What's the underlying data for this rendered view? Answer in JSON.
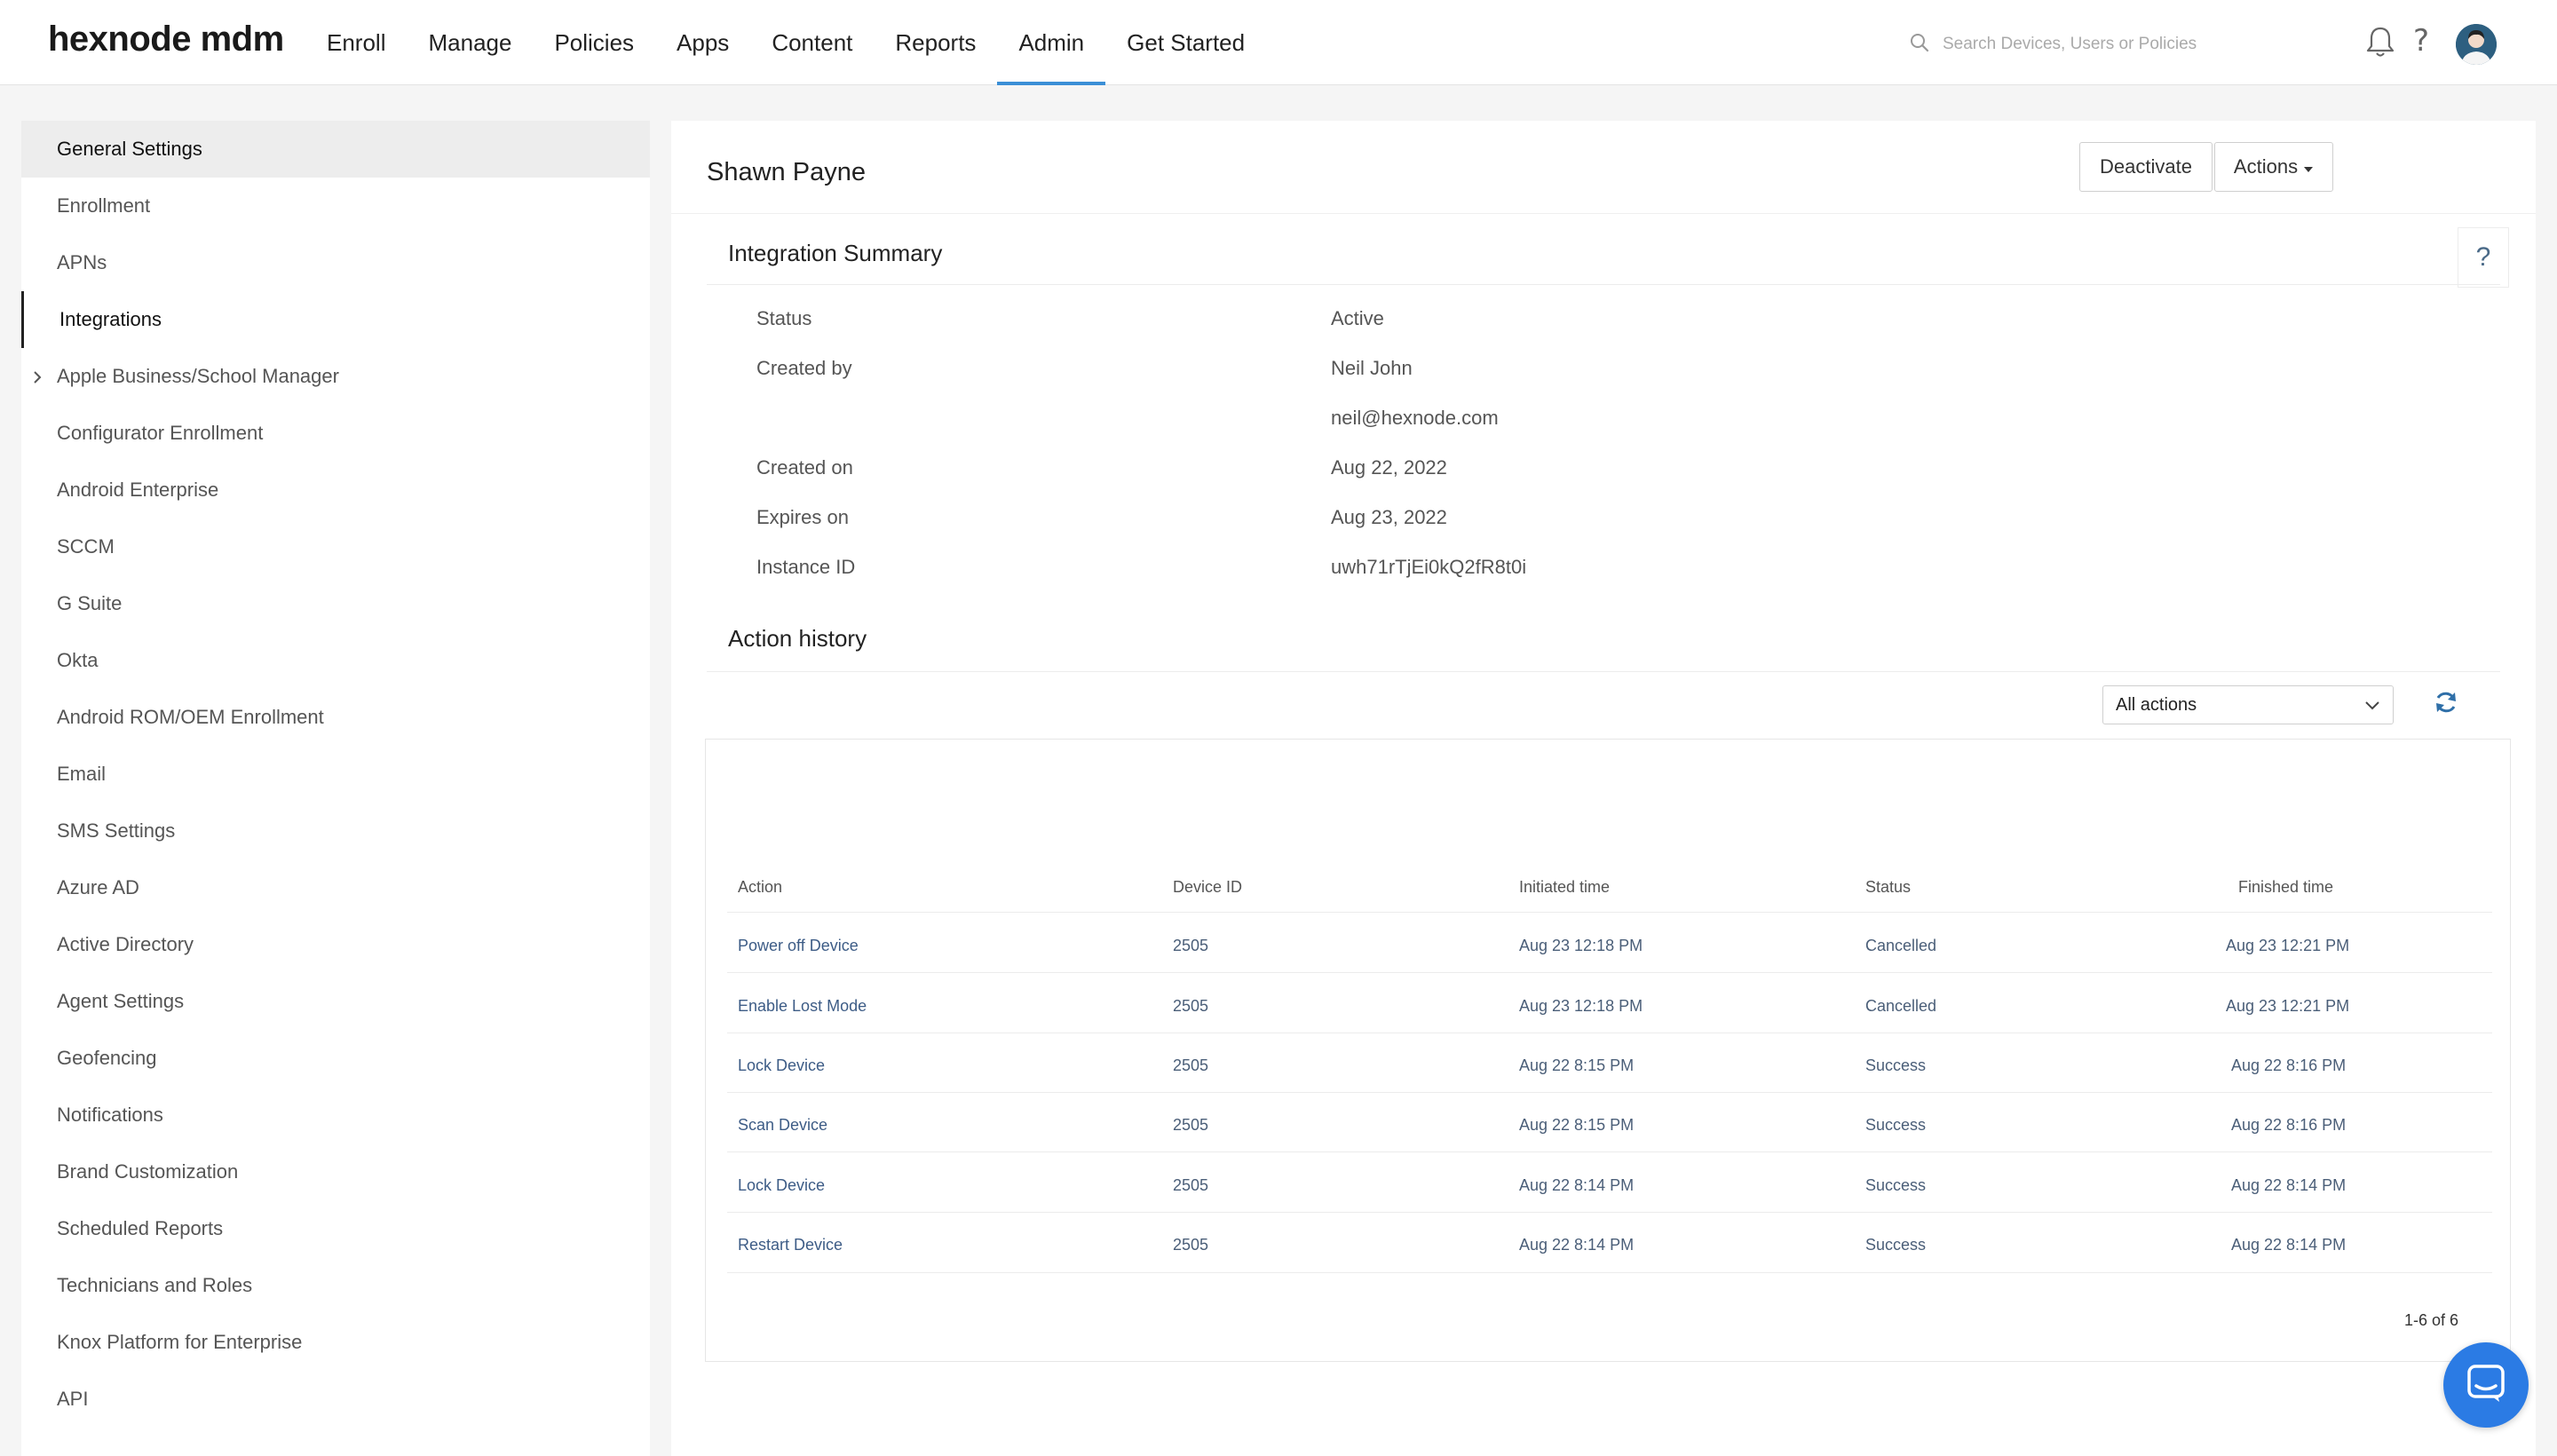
{
  "brand": "hexnode mdm",
  "nav": {
    "items": [
      "Enroll",
      "Manage",
      "Policies",
      "Apps",
      "Content",
      "Reports",
      "Admin",
      "Get Started"
    ],
    "active": "Admin"
  },
  "search": {
    "placeholder": "Search Devices, Users or Policies"
  },
  "sidebar": {
    "items": [
      "General Settings",
      "Enrollment",
      "APNs",
      "Integrations",
      "Apple Business/School Manager",
      "Configurator Enrollment",
      "Android Enterprise",
      "SCCM",
      "G Suite",
      "Okta",
      "Android ROM/OEM Enrollment",
      "Email",
      "SMS Settings",
      "Azure AD",
      "Active Directory",
      "Agent Settings",
      "Geofencing",
      "Notifications",
      "Brand Customization",
      "Scheduled Reports",
      "Technicians and Roles",
      "Knox Platform for Enterprise",
      "API"
    ],
    "selected": "Integrations"
  },
  "header": {
    "name": "Shawn Payne",
    "deactivate_label": "Deactivate",
    "actions_label": "Actions"
  },
  "summary": {
    "title": "Integration Summary",
    "help": "?",
    "status_label": "Status",
    "status_value": "Active",
    "created_by_label": "Created by",
    "created_by_value": "Neil John",
    "created_by_email": "neil@hexnode.com",
    "created_on_label": "Created on",
    "created_on_value": "Aug 22, 2022",
    "expires_on_label": "Expires on",
    "expires_on_value": "Aug 23, 2022",
    "instance_label": "Instance ID",
    "instance_value": "uwh71rTjEi0kQ2fR8t0i"
  },
  "history": {
    "title": "Action history",
    "filter_value": "All actions",
    "columns": [
      "Action",
      "Device ID",
      "Initiated time",
      "Status",
      "Finished time"
    ],
    "rows": [
      [
        "Power off Device",
        "2505",
        "Aug 23 12:18 PM",
        "Cancelled",
        "Aug 23 12:21 PM"
      ],
      [
        "Enable Lost Mode",
        "2505",
        "Aug 23 12:18 PM",
        "Cancelled",
        "Aug 23 12:21 PM"
      ],
      [
        "Lock Device",
        "2505",
        "Aug 22 8:15 PM",
        "Success",
        "Aug 22 8:16 PM"
      ],
      [
        "Scan Device",
        "2505",
        "Aug 22 8:15 PM",
        "Success",
        "Aug 22 8:16 PM"
      ],
      [
        "Lock Device",
        "2505",
        "Aug 22 8:14 PM",
        "Success",
        "Aug 22 8:14 PM"
      ],
      [
        "Restart Device",
        "2505",
        "Aug 22 8:14 PM",
        "Success",
        "Aug 22 8:14 PM"
      ]
    ],
    "pager": "1-6 of 6"
  },
  "colors": {
    "accent": "#3b8fd6",
    "link": "#3d5c86",
    "chat": "#2b7be4"
  },
  "icons": [
    "search-icon",
    "bell-icon",
    "help-icon",
    "avatar-icon",
    "chevron-right-icon",
    "caret-down-icon",
    "chevron-down-icon",
    "refresh-icon",
    "chat-icon"
  ]
}
